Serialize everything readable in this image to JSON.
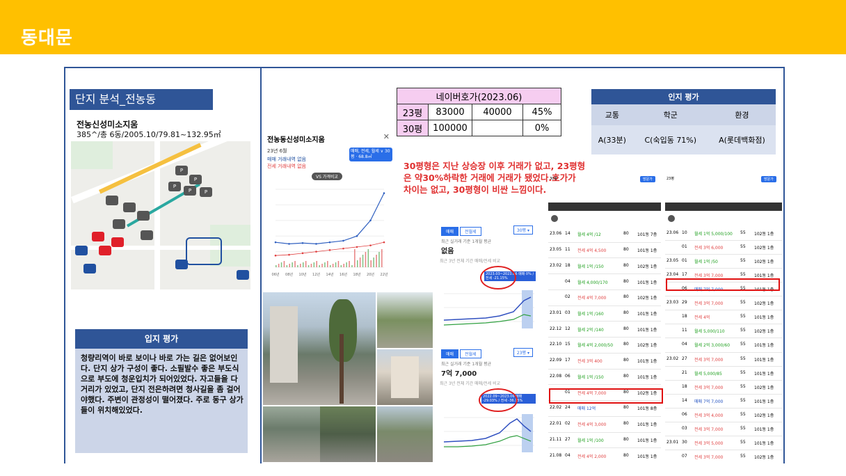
{
  "header": {
    "title": "동대문"
  },
  "left": {
    "section_title": "단지 분석_전농동",
    "complex_name": "전농신성미소지움",
    "complex_info": "385^/총 6동/2005.10/79.81~132.95㎡",
    "eval_title": "입지 평가",
    "eval_text": "청량리역이 바로 보이나 바로 가는 길은 없어보인다. 단지 상가 구성이 좋다. 소필발수 좋은 부도식으로 부도에 청운입치가 되어있었다. 자고들을 다 거리가 있었고, 단지 전은하려면 청사길을 좀 걸어야했다. 주변이 관정성이 떨어졌다. 주로 동구 상가들이 위치해있었다.",
    "map_pins": [
      "P",
      "P",
      "P",
      "P",
      "P"
    ]
  },
  "naver": {
    "title": "네이버호가(2023.06)",
    "rows": [
      {
        "label": "23평",
        "price": "83000",
        "jeonse": "40000",
        "ratio": "45%"
      },
      {
        "label": "30평",
        "price": "100000",
        "jeonse": "",
        "ratio": "0%"
      }
    ]
  },
  "ipji": {
    "title": "인지 평가",
    "cols": [
      "교통",
      "학군",
      "환경"
    ],
    "vals": [
      "A(33분)",
      "C(숙입동 71%)",
      "A(롯데백화점)"
    ]
  },
  "annotation": "30평형은 지난 상승장 이후 거래가 없고, 23평형은 약30%하락한 거래에 거래가 됐었다.호가가 차이는 없고, 30평형이 비싼 느낌이다.",
  "price_chart": {
    "title": "전농동신성미소지움",
    "date": "23년 6월",
    "legend1": "매매 거래내역 없음",
    "legend2": "전세 거래내역 없음",
    "badge": "매매, 전세, 월세 ∨ 30평 · 68.8㎡",
    "vs": "VS 가격비교"
  },
  "chart_data": {
    "type": "line",
    "title": "전농동신성미소지움",
    "xlabel": "",
    "ylabel": "",
    "x": [
      "06년",
      "08년",
      "10년",
      "12년",
      "14년",
      "16년",
      "18년",
      "20년",
      "22년"
    ],
    "series": [
      {
        "name": "매매",
        "values": [
          3.2,
          3.0,
          3.1,
          3.0,
          3.2,
          3.4,
          4.0,
          6.0,
          9.5
        ]
      },
      {
        "name": "전세",
        "values": [
          1.5,
          1.6,
          1.8,
          2.0,
          2.2,
          2.4,
          2.6,
          2.8,
          3.2
        ]
      }
    ]
  },
  "mid_cards": [
    {
      "tabs": [
        "매매",
        "전월세"
      ],
      "select": "30평 ▾",
      "caption": "최근 실거래 기준 1개월 평균",
      "value": "없음",
      "range": "최근 3년   전체 기간   매매/전세   비교",
      "box": "2023.03~2023.06 매매 0%  / 전세 -21.15%"
    },
    {
      "tabs": [
        "매매",
        "전월세"
      ],
      "select": "23평 ▾",
      "caption": "최근 실거래 기준 1개월 평균",
      "value": "7억 7,000",
      "range": "최근 3년   전체 기간   매매/전세   비교",
      "box": "2022.09~2023.06 매매 -29.03% / 전세 -36.15%"
    }
  ],
  "trade_tables": [
    {
      "tab": "30평",
      "rows": [
        [
          "23.06",
          "14",
          "월세 4억 /12",
          "80",
          "101동 7층"
        ],
        [
          "23.05",
          "11",
          "전세 4억 4,500",
          "80",
          "101동 1층"
        ],
        [
          "23.02",
          "18",
          "월세 1억 /150",
          "80",
          "102동 1층"
        ],
        [
          "",
          "04",
          "월세 4,000/170",
          "80",
          "101동 1층"
        ],
        [
          "",
          "02",
          "전세 4억 7,000",
          "80",
          "102동 1층"
        ],
        [
          "23.01",
          "03",
          "월세 1억 /160",
          "80",
          "101동 1층"
        ],
        [
          "22.12",
          "12",
          "월세 2억 /140",
          "80",
          "101동 1층"
        ],
        [
          "22.10",
          "15",
          "월세 4억 2,000/50",
          "80",
          "102동 1층"
        ],
        [
          "22.09",
          "17",
          "전세 3억 400",
          "80",
          "101동 1층"
        ],
        [
          "22.08",
          "06",
          "월세 1억 /150",
          "80",
          "101동 1층"
        ],
        [
          "",
          "01",
          "전세 4억 7,000",
          "80",
          "102동 1층"
        ],
        [
          "22.02",
          "24",
          "매매 12억",
          "80",
          "101동 8층"
        ],
        [
          "22.01",
          "02",
          "전세 4억 3,000",
          "80",
          "101동 1층"
        ],
        [
          "21.11",
          "27",
          "월세 1억 /100",
          "80",
          "101동 1층"
        ],
        [
          "21.08",
          "04",
          "전세 4억 2,000",
          "80",
          "101동 1층"
        ]
      ]
    },
    {
      "tab": "23평",
      "rows": [
        [
          "23.06",
          "10",
          "월세 1억 5,000/100",
          "55",
          "102동 1층"
        ],
        [
          "",
          "01",
          "전세 3억 6,000",
          "55",
          "102동 1층"
        ],
        [
          "23.05",
          "01",
          "월세 1억 /50",
          "55",
          "102동 1층"
        ],
        [
          "23.04",
          "17",
          "전세 3억 7,000",
          "55",
          "101동 1층"
        ],
        [
          "",
          "06",
          "매매 7억 7,000",
          "55",
          "101동 1층"
        ],
        [
          "23.03",
          "29",
          "전세 3억 7,000",
          "55",
          "102동 1층"
        ],
        [
          "",
          "18",
          "전세 4억",
          "55",
          "101동 1층"
        ],
        [
          "",
          "11",
          "월세 5,000/110",
          "55",
          "102동 1층"
        ],
        [
          "",
          "04",
          "월세 2억 3,000/60",
          "55",
          "101동 1층"
        ],
        [
          "23.02",
          "27",
          "전세 3억 7,000",
          "55",
          "101동 1층"
        ],
        [
          "",
          "21",
          "월세 5,000/85",
          "55",
          "101동 1층"
        ],
        [
          "",
          "18",
          "전세 3억 7,000",
          "55",
          "102동 1층"
        ],
        [
          "",
          "14",
          "매매 7억 7,000",
          "55",
          "101동 1층"
        ],
        [
          "",
          "06",
          "전세 3억 4,000",
          "55",
          "102동 1층"
        ],
        [
          "",
          "03",
          "전세 3억 7,000",
          "55",
          "101동 1층"
        ],
        [
          "23.01",
          "30",
          "전세 3억 5,000",
          "55",
          "101동 1층"
        ],
        [
          "",
          "07",
          "전세 3억 7,000",
          "55",
          "102동 1층"
        ]
      ]
    }
  ]
}
